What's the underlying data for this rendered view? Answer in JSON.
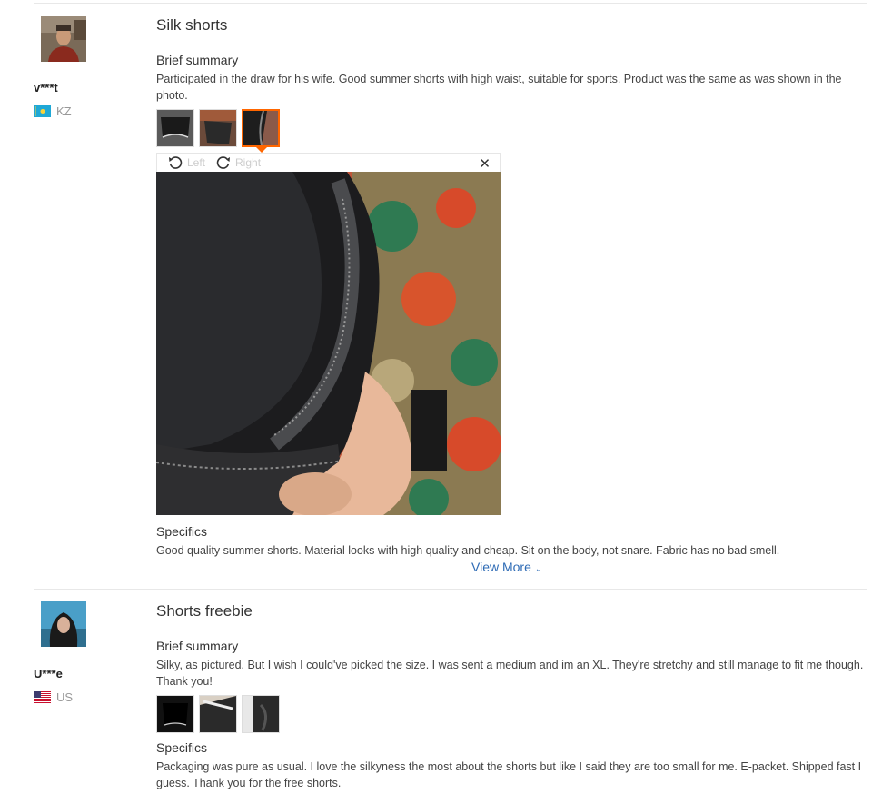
{
  "reviews": [
    {
      "username": "v***t",
      "country": "KZ",
      "title": "Silk shorts",
      "brief_heading": "Brief summary",
      "brief_text": "Participated in the draw for his wife. Good summer shorts with high waist, suitable for sports. Product was the same as was shown in the photo.",
      "specifics_heading": "Specifics",
      "specifics_text": "Good quality summer shorts. Material looks with high quality and cheap. Sit on the body, not snare. Fabric has no bad smell.",
      "view_more": "View More",
      "viewer": {
        "left_label": "Left",
        "right_label": "Right"
      }
    },
    {
      "username": "U***e",
      "country": "US",
      "title": "Shorts freebie",
      "brief_heading": "Brief summary",
      "brief_text": "Silky, as pictured. But I wish I could've picked the size. I was sent a medium and im an XL. They're stretchy and still manage to fit me though. Thank you!",
      "specifics_heading": "Specifics",
      "specifics_text": "Packaging was pure as usual. I love the silkyness the most about the shorts but like I said they are too small for me. E-packet. Shipped fast I guess. Thank you for the free shorts."
    }
  ],
  "colors": {
    "link": "#2e6bb5",
    "active_border": "#ff6600"
  },
  "icons": {
    "rotate_left": "rotate-left-icon",
    "rotate_right": "rotate-right-icon",
    "close": "close-icon",
    "chevron": "chevron-down-icon"
  }
}
